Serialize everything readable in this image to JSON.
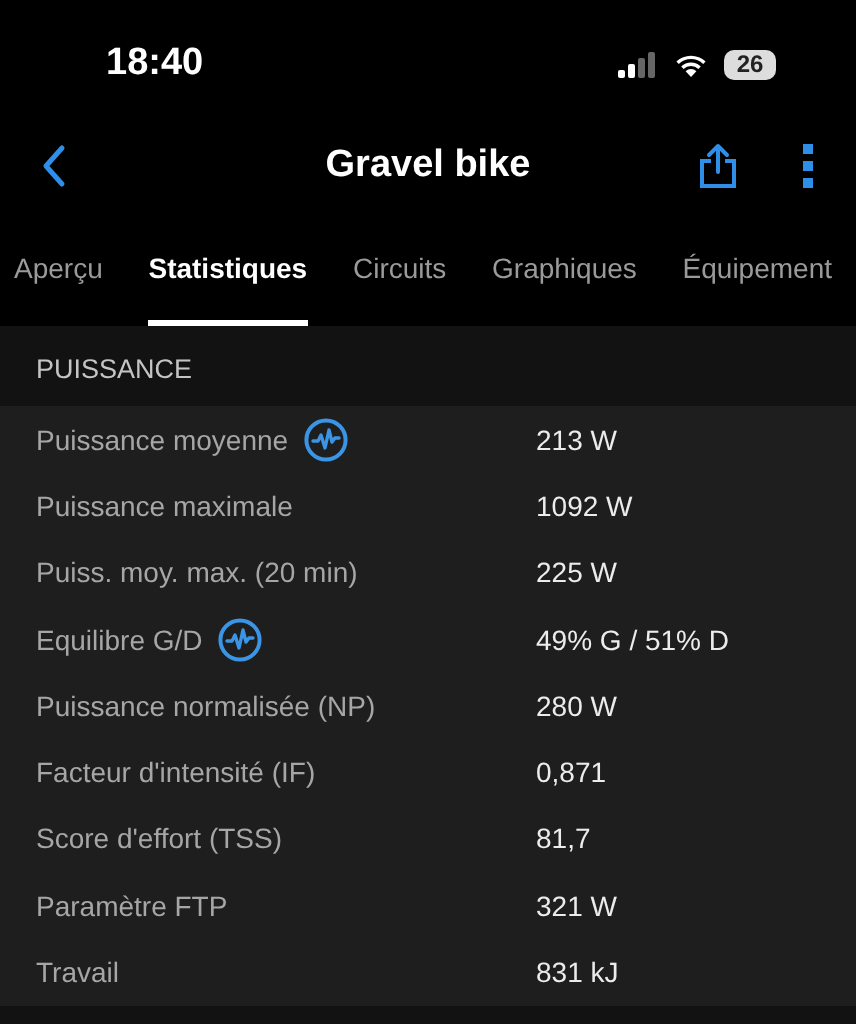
{
  "status_bar": {
    "time": "18:40",
    "battery": "26"
  },
  "nav": {
    "title": "Gravel bike"
  },
  "tabs": [
    {
      "label": "Aperçu",
      "selected": false
    },
    {
      "label": "Statistiques",
      "selected": true
    },
    {
      "label": "Circuits",
      "selected": false
    },
    {
      "label": "Graphiques",
      "selected": false
    },
    {
      "label": "Équipement",
      "selected": false
    }
  ],
  "section": {
    "title": "PUISSANCE",
    "rows": [
      {
        "label": "Puissance moyenne",
        "has_chart": true,
        "value": "213 W"
      },
      {
        "label": "Puissance maximale",
        "has_chart": false,
        "value": "1092 W"
      },
      {
        "label": "Puiss. moy. max. (20 min)",
        "has_chart": false,
        "value": "225 W"
      },
      {
        "label": "Equilibre G/D",
        "has_chart": true,
        "value": "49% G / 51% D"
      },
      {
        "label": "Puissance normalisée (NP)",
        "has_chart": false,
        "value": "280 W"
      },
      {
        "label": "Facteur d'intensité (IF)",
        "has_chart": false,
        "value": "0,871"
      },
      {
        "label": "Score d'effort (TSS)",
        "has_chart": false,
        "value": "81,7"
      },
      {
        "label": "Paramètre FTP",
        "has_chart": false,
        "value": "321 W"
      },
      {
        "label": "Travail",
        "has_chart": false,
        "value": "831 kJ"
      }
    ]
  }
}
